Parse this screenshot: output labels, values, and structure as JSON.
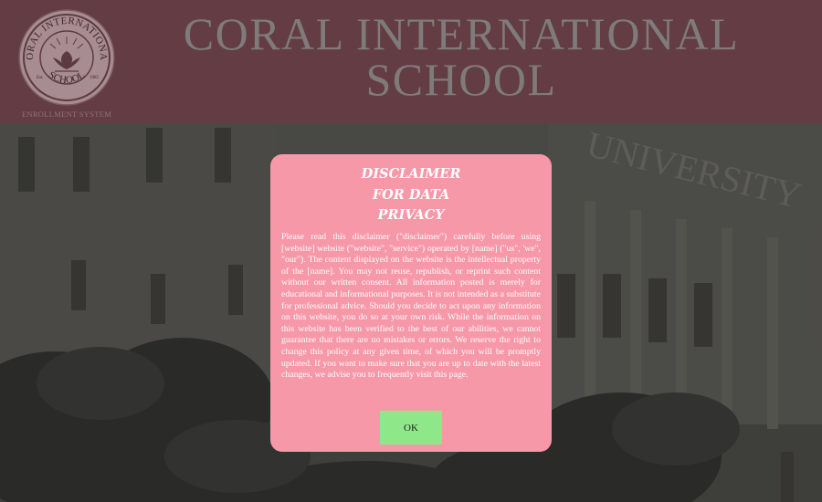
{
  "header": {
    "title_line1": "CORAL INTERNATIONAL",
    "title_line2": "SCHOOL",
    "logo": {
      "ring_text": "CORAL INTERNATIONAL",
      "bottom_text": "SCHOOL",
      "left_small": "Est.",
      "right_small": "1985"
    },
    "logo_caption": "ENROLLMENT SYSTEM"
  },
  "background": {
    "building_sign": "UNIVERSITY"
  },
  "modal": {
    "title_lines": [
      "DISCLAIMER",
      "FOR DATA",
      "PRIVACY"
    ],
    "body": "Please read this disclaimer (\"disclaimer\") carefully before using [website] website (\"website\", \"service\") operated by [name] (\"us\", 'we\", \"our\"). The content displayed on the website is the intellectual property of the [name]. You may not reuse, republish, or reprint such content without our written consent. All information posted is merely for educational and informational purposes. It is not intended as a substitute for professional advice. Should you decide to act upon any information on this website, you do so at your own risk. While the information on this website has been verified to the best of our abilities, we cannot guarantee that there are no mistakes or errors. We reserve the right to change this policy at any given time, of which you will be promptly updated. If you want to make sure that you are up to date with the latest changes, we advise you to frequently visit this page.",
    "ok_label": "OK"
  },
  "colors": {
    "header_bg": "#643c43",
    "title_text": "#7f7b7b",
    "modal_bg": "#f798a8",
    "ok_button_bg": "#8ee88a"
  }
}
